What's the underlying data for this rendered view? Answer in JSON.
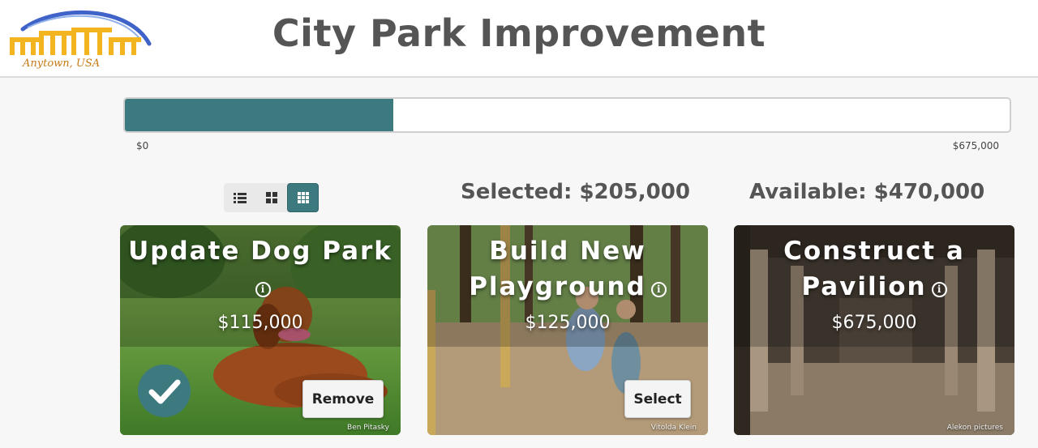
{
  "header": {
    "title": "City Park Improvement",
    "logo_text": "Anytown, USA"
  },
  "budget": {
    "min_label": "$0",
    "max_label": "$675,000",
    "selected_fraction": 0.3037,
    "selected_label": "Selected: $205,000",
    "available_label": "Available: $470,000"
  },
  "view_toggle": {
    "options": [
      "list-view-icon",
      "grid-large-icon",
      "grid-small-icon"
    ],
    "active": "grid-small-icon"
  },
  "projects": [
    {
      "title": "Update Dog Park",
      "price": "$115,000",
      "button": "Remove",
      "selected": true,
      "photo_credit": "Ben Pitasky"
    },
    {
      "title": "Build New Playground",
      "price": "$125,000",
      "button": "Select",
      "selected": false,
      "photo_credit": "Vitolda Klein"
    },
    {
      "title": "Construct a Pavilion",
      "price": "$675,000",
      "button": "",
      "selected": false,
      "photo_credit": "Alekon pictures"
    }
  ],
  "colors": {
    "accent": "#3d7a80",
    "logo_gold": "#f2b51f",
    "logo_blue": "#3f63c8"
  }
}
